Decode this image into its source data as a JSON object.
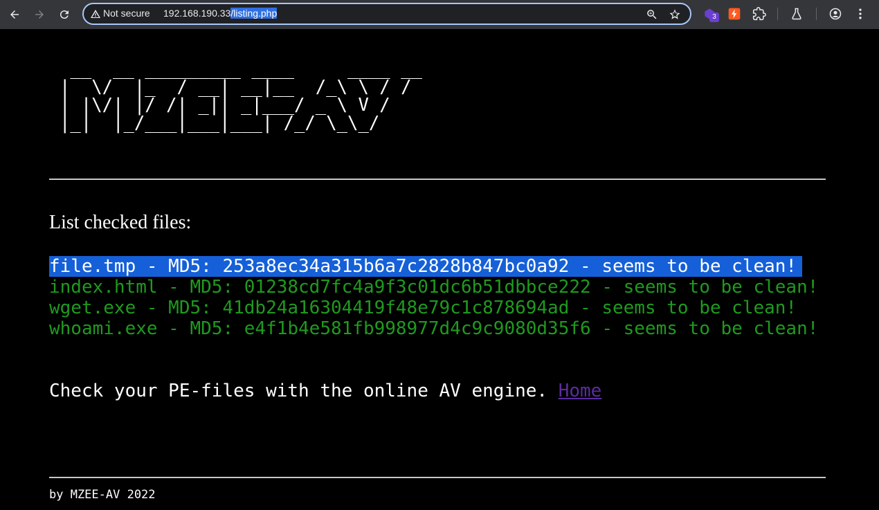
{
  "browser": {
    "security_label": "Not secure",
    "url_host": "192.168.190.33",
    "url_path": "/listing.php",
    "extension_badge": "3",
    "icons": [
      "back-icon",
      "forward-icon",
      "reload-icon",
      "warning-icon",
      "zoom-icon",
      "bookmark-star-icon",
      "extension-icon",
      "bolt-extension-icon",
      "puzzle-icon",
      "flask-icon",
      "profile-icon",
      "kebab-menu-icon"
    ],
    "colors": {
      "toolbar": "#35363a",
      "omnibox_border": "#a8c7fa",
      "selection": "#2f6fe0"
    }
  },
  "page": {
    "ascii_logo": " __  __ _________ ____     ____ __\n|  \\/  |_  / __| __|__  /_\\ \\ / /\n| |\\/| |/ /| _|| _|___/ _ \\ V /\n|_|  |_/___|___|___| /_/ \\_\\_/",
    "heading": "List checked files:",
    "files": [
      {
        "text": "file.tmp - MD5: 253a8ec34a315b6a7c2828b847bc0a92 - seems to be clean!",
        "selected": true
      },
      {
        "text": "index.html - MD5: 01238cd7fc4a9f3c01dc6b51dbbce222 - seems to be clean!",
        "selected": false
      },
      {
        "text": "wget.exe - MD5: 41db24a16304419f48e79c1c878694ad - seems to be clean!",
        "selected": false
      },
      {
        "text": "whoami.exe - MD5: e4f1b4e581fb998977d4c9c9080d35f6 - seems to be clean!",
        "selected": false
      }
    ],
    "cta_text": "Check your PE-files with the online AV engine. ",
    "home_link": "Home",
    "footer": "by MZEE-AV 2022",
    "colors": {
      "background": "#000000",
      "clean_text": "#1f9a1f",
      "link": "#5b2ca0",
      "highlight": "#1560d8"
    }
  }
}
